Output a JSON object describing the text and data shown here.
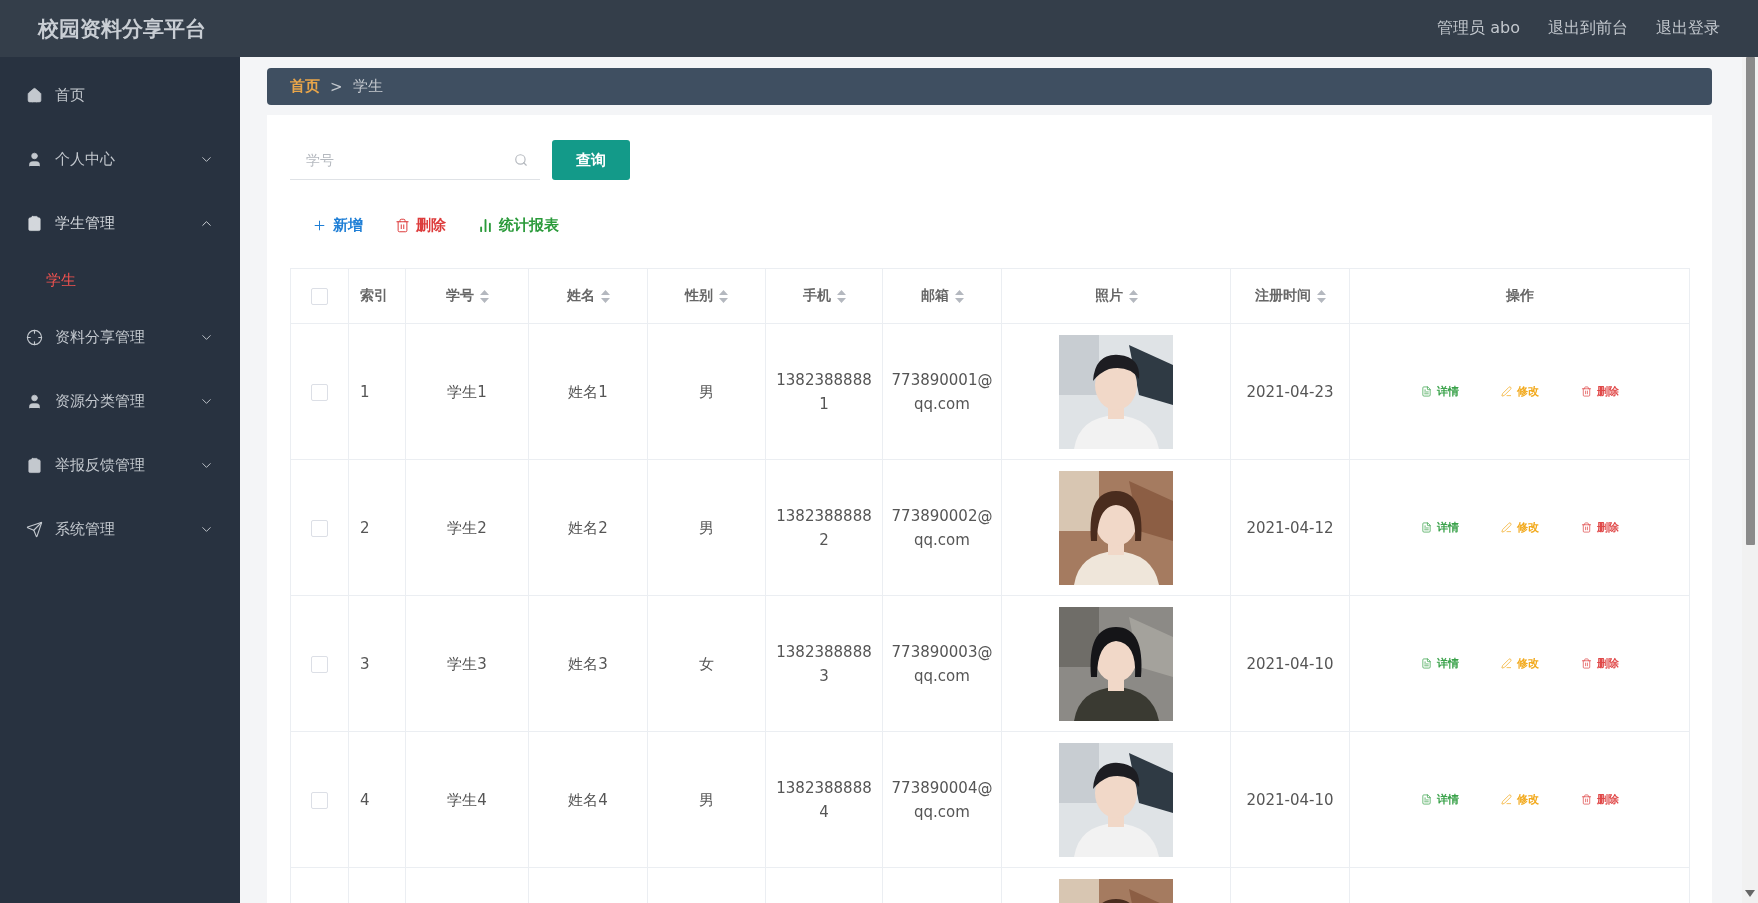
{
  "header": {
    "title": "校园资料分享平台",
    "links": [
      {
        "label": "管理员 abo"
      },
      {
        "label": "退出到前台"
      },
      {
        "label": "退出登录"
      }
    ]
  },
  "sidebar": {
    "items": [
      {
        "label": "首页"
      },
      {
        "label": "个人中心",
        "expanded": false
      },
      {
        "label": "学生管理",
        "expanded": true,
        "children": [
          {
            "label": "学生",
            "selected": true
          }
        ]
      },
      {
        "label": "资料分享管理",
        "expanded": false
      },
      {
        "label": "资源分类管理",
        "expanded": false
      },
      {
        "label": "举报反馈管理",
        "expanded": false
      },
      {
        "label": "系统管理",
        "expanded": false
      }
    ]
  },
  "breadcrumb": [
    {
      "label": "首页",
      "current": false
    },
    {
      "label": "学生",
      "current": true
    }
  ],
  "breadcrumb_separator": ">",
  "search": {
    "placeholder": "学号",
    "button": "查询"
  },
  "toolbar": [
    {
      "kind": "add",
      "label": "新增"
    },
    {
      "kind": "delete",
      "label": "删除"
    },
    {
      "kind": "report",
      "label": "统计报表"
    }
  ],
  "table": {
    "header_checked": false,
    "columns": [
      {
        "label": "索引"
      },
      {
        "label": "学号",
        "sortable": true
      },
      {
        "label": "姓名",
        "sortable": true
      },
      {
        "label": "性别",
        "sortable": true
      },
      {
        "label": "手机",
        "sortable": true
      },
      {
        "label": "邮箱",
        "sortable": true
      },
      {
        "label": "照片",
        "sortable": true
      },
      {
        "label": "注册时间",
        "sortable": true
      },
      {
        "label": "操作"
      }
    ],
    "rows": [
      {
        "checked": false,
        "index": "1",
        "student_id": "学生1",
        "name": "姓名1",
        "gender": "男",
        "phone": "13823888881",
        "email": "773890001@qq.com",
        "photo": {
          "kind": "picture"
        },
        "registered": "2021-04-23",
        "actions": [
          {
            "kind": "detail",
            "label": "详情"
          },
          {
            "kind": "edit",
            "label": "修改"
          },
          {
            "kind": "delete",
            "label": "删除"
          }
        ]
      },
      {
        "checked": false,
        "index": "2",
        "student_id": "学生2",
        "name": "姓名2",
        "gender": "男",
        "phone": "13823888882",
        "email": "773890002@qq.com",
        "photo": {
          "kind": "picture"
        },
        "registered": "2021-04-12",
        "actions": [
          {
            "kind": "detail",
            "label": "详情"
          },
          {
            "kind": "edit",
            "label": "修改"
          },
          {
            "kind": "delete",
            "label": "删除"
          }
        ]
      },
      {
        "checked": false,
        "index": "3",
        "student_id": "学生3",
        "name": "姓名3",
        "gender": "女",
        "phone": "13823888883",
        "email": "773890003@qq.com",
        "photo": {
          "kind": "picture"
        },
        "registered": "2021-04-10",
        "actions": [
          {
            "kind": "detail",
            "label": "详情"
          },
          {
            "kind": "edit",
            "label": "修改"
          },
          {
            "kind": "delete",
            "label": "删除"
          }
        ]
      },
      {
        "checked": false,
        "index": "4",
        "student_id": "学生4",
        "name": "姓名4",
        "gender": "男",
        "phone": "13823888884",
        "email": "773890004@qq.com",
        "photo": {
          "kind": "picture"
        },
        "registered": "2021-04-10",
        "actions": [
          {
            "kind": "detail",
            "label": "详情"
          },
          {
            "kind": "edit",
            "label": "修改"
          },
          {
            "kind": "delete",
            "label": "删除"
          }
        ]
      },
      {
        "photo": {
          "kind": "picture"
        }
      }
    ]
  }
}
